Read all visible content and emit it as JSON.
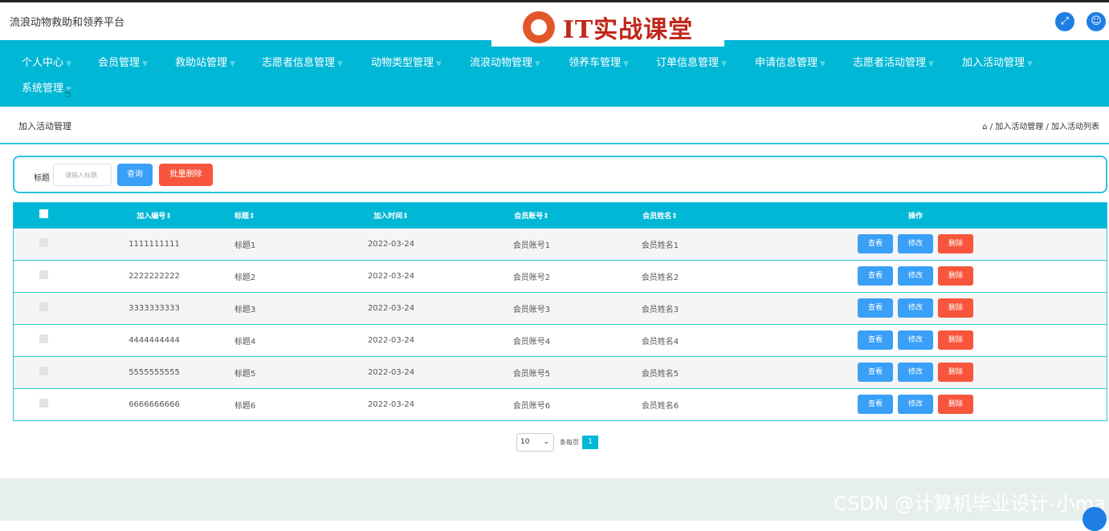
{
  "app": {
    "title": "流浪动物救助和领养平台",
    "watermark_logo": "IT实战课堂",
    "fullscreen_icon": "expand-arrows-icon",
    "user_icon": "user-icon"
  },
  "nav": {
    "items": [
      {
        "label": "个人中心"
      },
      {
        "label": "会员管理"
      },
      {
        "label": "救助站管理"
      },
      {
        "label": "志愿者信息管理"
      },
      {
        "label": "动物类型管理"
      },
      {
        "label": "流浪动物管理"
      },
      {
        "label": "领养车管理"
      },
      {
        "label": "订单信息管理"
      },
      {
        "label": "申请信息管理"
      },
      {
        "label": "志愿者活动管理"
      },
      {
        "label": "加入活动管理"
      },
      {
        "label": "系统管理"
      }
    ]
  },
  "page": {
    "section_title": "加入活动管理",
    "breadcrumb": [
      "加入活动管理",
      "加入活动列表"
    ]
  },
  "search": {
    "label": "标题",
    "placeholder": "请输入标题",
    "query_label": "查询",
    "batch_delete_label": "批量删除"
  },
  "table": {
    "headers": [
      "加入编号",
      "标题",
      "加入时间",
      "会员账号",
      "会员姓名",
      "操作"
    ],
    "rows": [
      {
        "id": "1111111111",
        "title": "标题1",
        "time": "2022-03-24",
        "account": "会员账号1",
        "name": "会员姓名1"
      },
      {
        "id": "2222222222",
        "title": "标题2",
        "time": "2022-03-24",
        "account": "会员账号2",
        "name": "会员姓名2"
      },
      {
        "id": "3333333333",
        "title": "标题3",
        "time": "2022-03-24",
        "account": "会员账号3",
        "name": "会员姓名3"
      },
      {
        "id": "4444444444",
        "title": "标题4",
        "time": "2022-03-24",
        "account": "会员账号4",
        "name": "会员姓名4"
      },
      {
        "id": "5555555555",
        "title": "标题5",
        "time": "2022-03-24",
        "account": "会员账号5",
        "name": "会员姓名5"
      },
      {
        "id": "6666666666",
        "title": "标题6",
        "time": "2022-03-24",
        "account": "会员账号6",
        "name": "会员姓名6"
      }
    ],
    "actions": {
      "view": "查看",
      "edit": "修改",
      "delete": "删除"
    }
  },
  "pager": {
    "page_size": "10",
    "per_page_label": "条每页",
    "current_page": "1"
  },
  "footer": {
    "watermark": "CSDN @计算机毕业设计-小ma"
  },
  "colors": {
    "nav_bg": "#00b7d6",
    "primary": "#3a9ff7",
    "danger": "#f7553c",
    "accent_border": "#2fc3dc"
  }
}
